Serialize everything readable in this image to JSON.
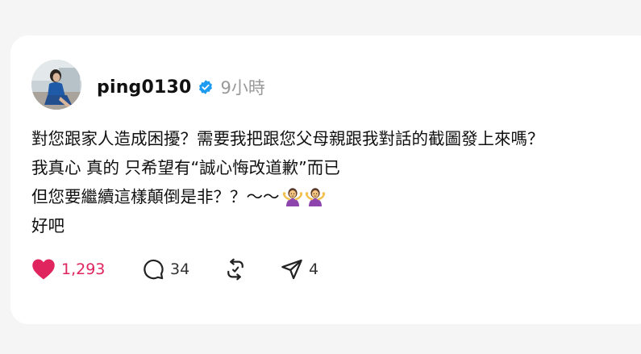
{
  "post": {
    "username": "ping0130",
    "time": "9小時",
    "body_lines": [
      "對您跟家人造成困擾？需要我把跟您父母親跟我對話的截圖發上來嗎？",
      "我真心 真的 只希望有“誠心悔改道歉”而已",
      "但您要繼續這樣顛倒是非？？～～",
      "好吧"
    ],
    "emojis": [
      "person-shrugging-emoji",
      "person-shrugging-emoji"
    ]
  },
  "actions": {
    "likes": "1,293",
    "comments": "34",
    "reposts": "",
    "shares": "4"
  },
  "colors": {
    "like": "#e0245e",
    "verified": "#1d9bf0",
    "muted": "#999999",
    "text": "#111111",
    "background": "#f5f5f5",
    "card": "#ffffff"
  }
}
